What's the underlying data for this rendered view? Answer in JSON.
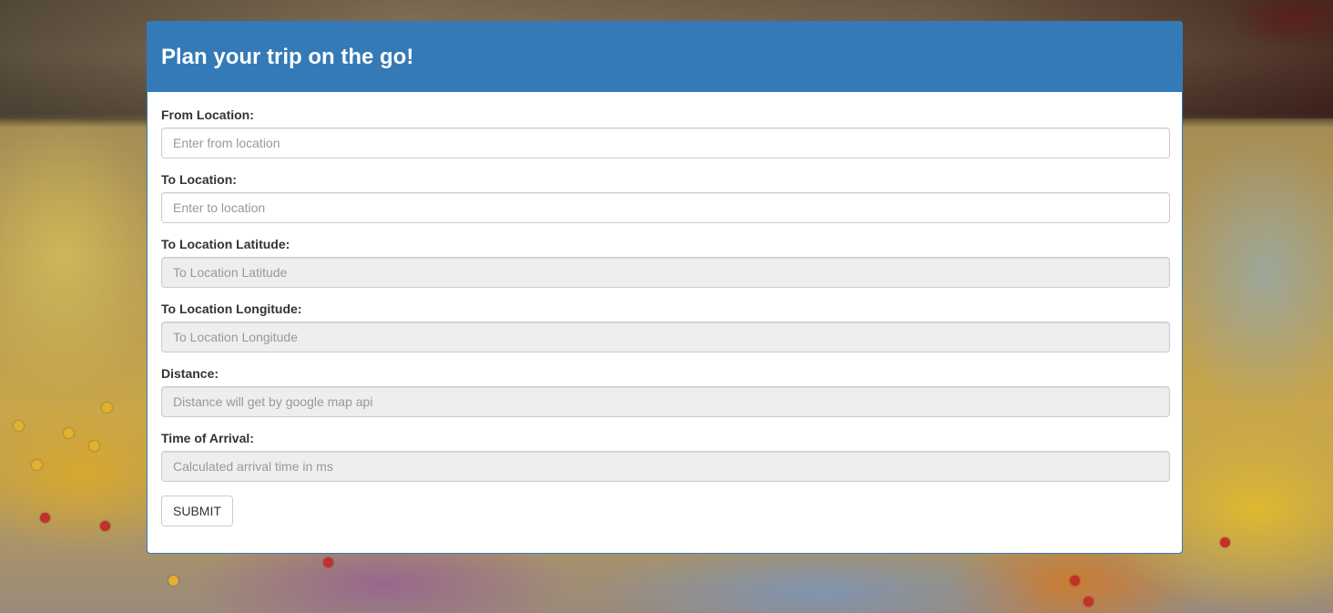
{
  "header": {
    "title": "Plan your trip on the go!"
  },
  "form": {
    "from_location": {
      "label": "From Location:",
      "placeholder": "Enter from location",
      "value": ""
    },
    "to_location": {
      "label": "To Location:",
      "placeholder": "Enter to location",
      "value": ""
    },
    "to_latitude": {
      "label": "To Location Latitude:",
      "placeholder": "To Location Latitude",
      "value": ""
    },
    "to_longitude": {
      "label": "To Location Longitude:",
      "placeholder": "To Location Longitude",
      "value": ""
    },
    "distance": {
      "label": "Distance:",
      "placeholder": "Distance will get by google map api",
      "value": ""
    },
    "arrival_time": {
      "label": "Time of Arrival:",
      "placeholder": "Calculated arrival time in ms",
      "value": ""
    },
    "submit_label": "SUBMIT"
  },
  "colors": {
    "primary": "#337ab7",
    "readonly_bg": "#eeeeee",
    "text": "#333333",
    "placeholder": "#999999"
  },
  "background": {
    "description_icon": "map-with-pins-background"
  }
}
